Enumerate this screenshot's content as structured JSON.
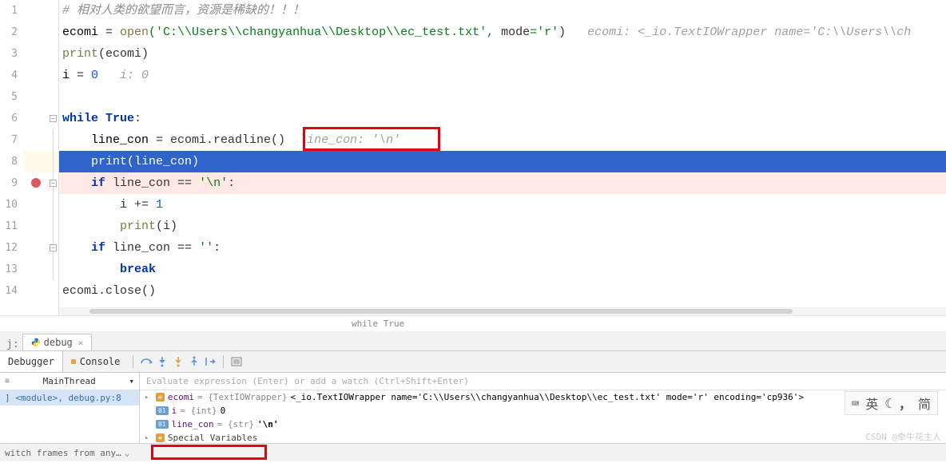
{
  "editor": {
    "lines": [
      "1",
      "2",
      "3",
      "4",
      "5",
      "6",
      "7",
      "8",
      "9",
      "10",
      "11",
      "12",
      "13",
      "14"
    ],
    "code": {
      "l1_comment": "# 相对人类的欲望而言，资源是稀缺的！！！",
      "l2_var": "ecomi",
      "l2_eq": " = ",
      "l2_open": "open",
      "l2_args": "('C:\\\\Users\\\\changyanhua\\\\Desktop\\\\ec_test.txt', ",
      "l2_mode_k": "mode",
      "l2_mode_v": "='r'",
      "l2_close": ")",
      "l2_inlay": "   ecomi: <_io.TextIOWrapper name='C:\\\\Users\\\\ch",
      "l3_print": "print",
      "l3_args": "(ecomi)",
      "l4_var": "i",
      "l4_eq": " = ",
      "l4_val": "0",
      "l4_inlay": "   i: 0",
      "l6_while": "while ",
      "l6_true": "True",
      "l6_colon": ":",
      "l7_indent": "    line_con = ecomi.readline()",
      "l7_var": "line_con",
      "l7_eq": " = ecomi.readline()",
      "l7_inlay": "  line_con: '\\n'",
      "l8_indent": "    ",
      "l8_print": "print",
      "l8_args": "(line_con)",
      "l9_indent": "    ",
      "l9_if": "if ",
      "l9_cond": "line_con == ",
      "l9_str": "'\\n'",
      "l9_colon": ":",
      "l10_indent": "        i += ",
      "l10_val": "1",
      "l11_indent": "        ",
      "l11_print": "print",
      "l11_args": "(i)",
      "l12_indent": "    ",
      "l12_if": "if ",
      "l12_cond": "line_con == ",
      "l12_str": "''",
      "l12_colon": ":",
      "l13_indent": "        ",
      "l13_break": "break",
      "l14": "ecomi.close()"
    },
    "breadcrumb": "while True"
  },
  "debug": {
    "tab_label": "debug",
    "subtab_debugger": "Debugger",
    "subtab_console": "Console",
    "thread": "MainThread",
    "frame": "<module>, debug.py:8",
    "watch_placeholder": "Evaluate expression (Enter) or add a watch (Ctrl+Shift+Enter)",
    "vars": {
      "v1_name": "ecomi",
      "v1_type": " = {TextIOWrapper} ",
      "v1_val": "<_io.TextIOWrapper name='C:\\\\Users\\\\changyanhua\\\\Desktop\\\\ec_test.txt' mode='r' encoding='cp936'>",
      "v2_name": "i",
      "v2_type": " = {int} ",
      "v2_val": "0",
      "v3_name": "line_con",
      "v3_type": " = {str} ",
      "v3_val": "'\\n'",
      "v4_name": "Special Variables"
    }
  },
  "status": {
    "left": "witch frames from any…"
  },
  "ime": {
    "t1": "英",
    "t2": "，",
    "t3": "简"
  },
  "watermark": "CSDN @牵牛花主人"
}
